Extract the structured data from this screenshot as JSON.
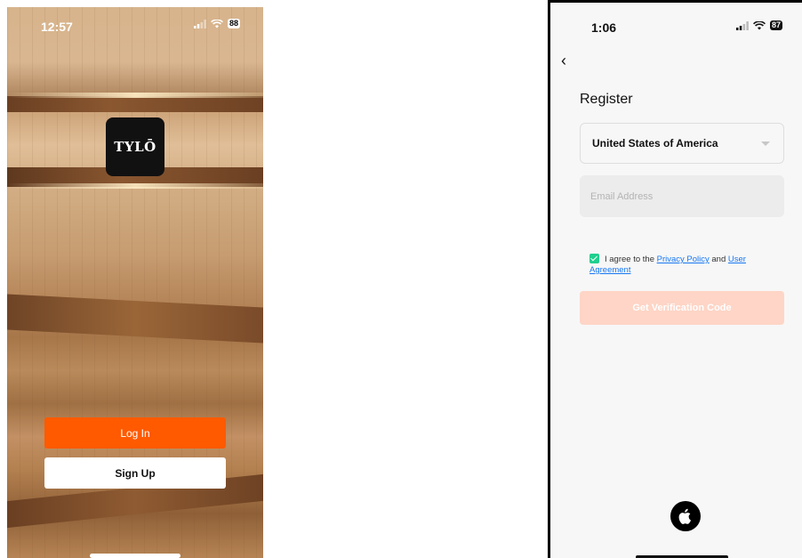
{
  "left_screen": {
    "status": {
      "time": "12:57",
      "battery": "88"
    },
    "logo_text": "TYLŌ",
    "login_label": "Log In",
    "signup_label": "Sign Up",
    "colors": {
      "primary": "#ff5a00"
    }
  },
  "right_screen": {
    "status": {
      "time": "1:06",
      "battery": "87"
    },
    "back_symbol": "‹",
    "title": "Register",
    "country": {
      "selected": "United States of America"
    },
    "email": {
      "placeholder": "Email Address",
      "value": ""
    },
    "agreement": {
      "prefix": "I agree to the",
      "privacy_link": "Privacy Policy",
      "conjunction": "and",
      "user_link": "User Agreement",
      "checked": true
    },
    "verify_label": "Get Verification Code",
    "apple_icon": "apple-icon",
    "colors": {
      "checkbox": "#1fcf8e",
      "link": "#1877f2",
      "verify_button": "#ffd2c1"
    }
  }
}
